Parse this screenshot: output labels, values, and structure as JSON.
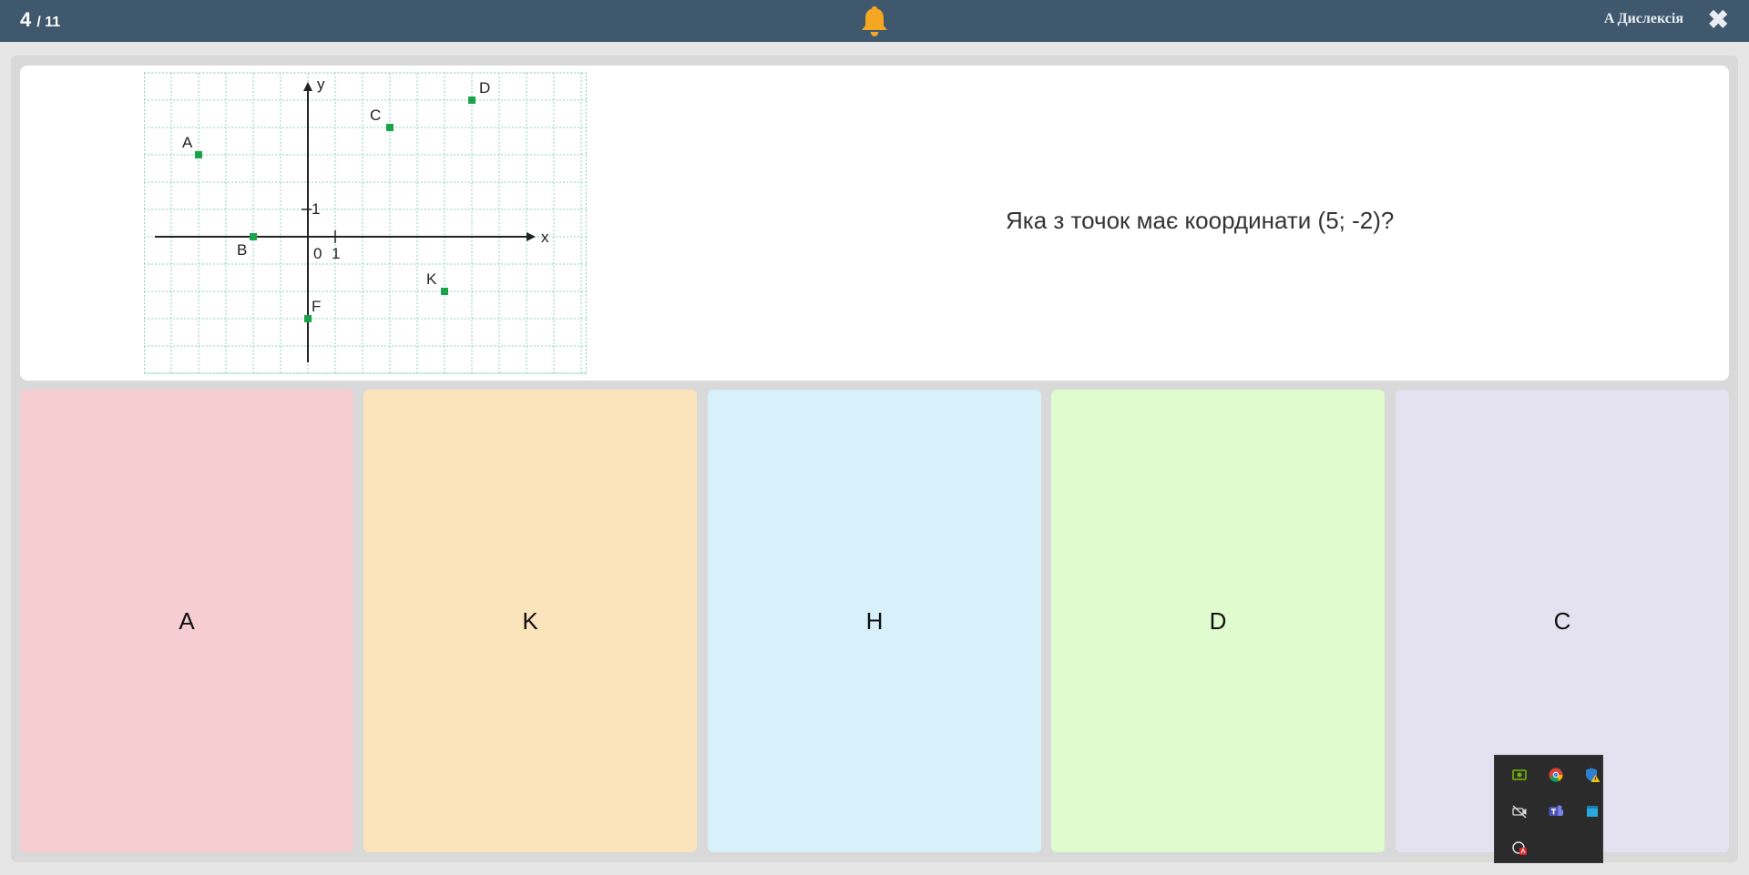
{
  "header": {
    "counter_current": "4",
    "counter_total": "/ 11",
    "bell_icon": "bell-icon",
    "dyslexia_label": "A Дислексія",
    "close_label": "✖",
    "bar_color": "#3f586e",
    "bell_color": "#f5a623"
  },
  "question": {
    "text": "Яка з точок має координати (5; -2)?",
    "graph": {
      "x_axis_label": "x",
      "y_axis_label": "y",
      "origin_label": "0",
      "unit_x_label": "1",
      "unit_y_label": "1",
      "points": [
        {
          "name": "A",
          "x": -4,
          "y": 3
        },
        {
          "name": "B",
          "x": -2,
          "y": 0
        },
        {
          "name": "C",
          "x": 3,
          "y": 4
        },
        {
          "name": "D",
          "x": 6,
          "y": 5
        },
        {
          "name": "K",
          "x": 5,
          "y": -2
        },
        {
          "name": "F",
          "x": 0,
          "y": -3
        }
      ],
      "point_color": "#1aa34a",
      "grid_color": "#8fd0c0"
    }
  },
  "answers": [
    {
      "label": "A",
      "color": "#f6cdd0"
    },
    {
      "label": "K",
      "color": "#fbe3bb"
    },
    {
      "label": "H",
      "color": "#d8f0fa"
    },
    {
      "label": "D",
      "color": "#e0fccf"
    },
    {
      "label": "C",
      "color": "#e4e2f1"
    }
  ],
  "tray": {
    "icons": [
      "nvidia-icon",
      "chrome-icon",
      "defender-warning-icon",
      "camera-off-icon",
      "teams-icon",
      "app-square-icon",
      "adobe-icon"
    ]
  }
}
